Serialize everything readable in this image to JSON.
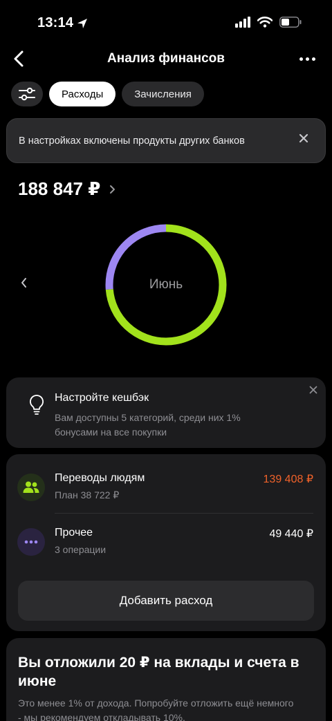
{
  "status": {
    "time": "13:14"
  },
  "nav": {
    "title": "Анализ финансов"
  },
  "filters": {
    "tab_expenses": "Расходы",
    "tab_income": "Зачисления"
  },
  "banner": {
    "text": "В настройках включены продукты других банков"
  },
  "total": {
    "amount": "188 847 ₽"
  },
  "donut": {
    "label": "Июнь",
    "segments": [
      {
        "share": 0.737,
        "color": "#a2e21c"
      },
      {
        "share": 0.263,
        "color": "#9d87f2"
      }
    ]
  },
  "cashback": {
    "title": "Настройте кешбэк",
    "subtitle": "Вам доступны 5 категорий, среди них 1% бонусами на все покупки"
  },
  "expenses": {
    "items": [
      {
        "name": "Переводы людям",
        "sub": "План 38 722 ₽",
        "amount": "139 408 ₽",
        "amount_color": "#f0622a",
        "icon": "people-icon",
        "icon_color": "#a2e21c"
      },
      {
        "name": "Прочее",
        "sub": "3 операции",
        "amount": "49 440 ₽",
        "amount_color": "#ffffff",
        "icon": "dots-icon",
        "icon_color": "#9d87f2"
      }
    ],
    "add_label": "Добавить расход"
  },
  "savings": {
    "title": "Вы отложили 20 ₽ на вклады и счета в июне",
    "text": "Это менее 1% от дохода. Попробуйте отложить ещё немного - мы рекомендуем откладывать 10%."
  }
}
